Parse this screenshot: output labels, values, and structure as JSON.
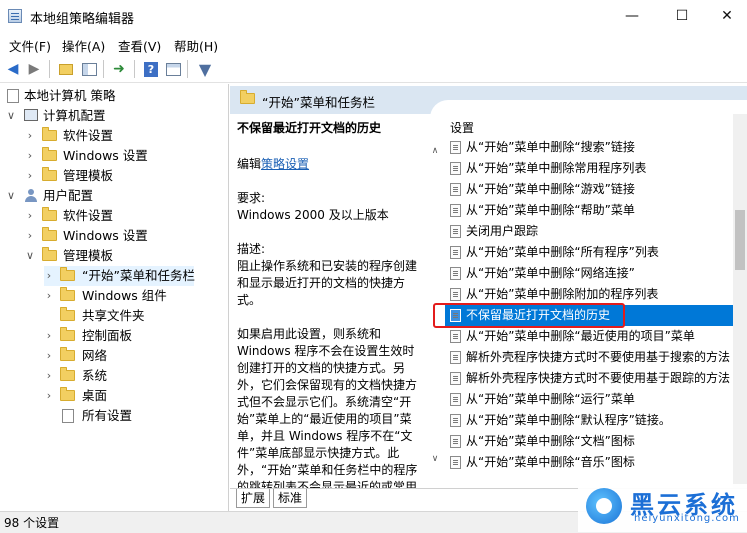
{
  "window": {
    "title": "本地组策略编辑器",
    "minimize": "—",
    "maximize": "☐",
    "close": "✕"
  },
  "menu": [
    "文件(F)",
    "操作(A)",
    "查看(V)",
    "帮助(H)"
  ],
  "toolbar": {
    "icons": [
      "back-icon",
      "forward-icon",
      "folder-up-icon",
      "show-hide-tree-icon",
      "export-icon",
      "help-icon",
      "properties-icon",
      "filter-icon"
    ]
  },
  "tree": {
    "root": "本地计算机 策略",
    "computer": "计算机配置",
    "computer_children": [
      "软件设置",
      "Windows 设置",
      "管理模板"
    ],
    "user": "用户配置",
    "user_children": [
      "软件设置",
      "Windows 设置",
      "管理模板"
    ],
    "admin_children": [
      "“开始”菜单和任务栏",
      "Windows 组件",
      "共享文件夹",
      "控制面板",
      "网络",
      "系统",
      "桌面",
      "所有设置"
    ],
    "expand_open": "∨",
    "expand_closed": "›"
  },
  "header": {
    "title": "“开始”菜单和任务栏"
  },
  "description": {
    "title": "不保留最近打开文档的历史",
    "edit_prefix": "编辑",
    "edit_link": "策略设置",
    "requirements_label": "要求:",
    "requirements": "Windows 2000 及以上版本",
    "desc_label": "描述:",
    "desc": "阻止操作系统和已安装的程序创建和显示最近打开的文档的快捷方式。",
    "detail": "如果启用此设置，则系统和 Windows 程序不会在设置生效时创建打开的文档的快捷方式。另外，它们会保留现有的文档快捷方式但不会显示它们。系统清空“开始”菜单上的“最近使用的项目”菜单，并且 Windows 程序不在“文件”菜单底部显示快捷方式。此外，“开始”菜单和任务栏中的程序的跳转列表不会显示最近的或常用的文件"
  },
  "settings": {
    "header": "设置",
    "items": [
      "从“开始”菜单中删除“搜索”链接",
      "从“开始”菜单中删除常用程序列表",
      "从“开始”菜单中删除“游戏”链接",
      "从“开始”菜单中删除“帮助”菜单",
      "关闭用户跟踪",
      "从“开始”菜单中删除“所有程序”列表",
      "从“开始”菜单中删除“网络连接”",
      "从“开始”菜单中删除附加的程序列表",
      "不保留最近打开文档的历史",
      "从“开始”菜单中删除“最近使用的项目”菜单",
      "解析外壳程序快捷方式时不要使用基于搜索的方法",
      "解析外壳程序快捷方式时不要使用基于跟踪的方法",
      "从“开始”菜单中删除“运行”菜单",
      "从“开始”菜单中删除“默认程序”链接。",
      "从“开始”菜单中删除“文档”图标",
      "从“开始”菜单中删除“音乐”图标"
    ],
    "selected_index": 8
  },
  "tabs": [
    "扩展",
    "标准"
  ],
  "status": "98 个设置",
  "watermark": {
    "text": "黑云系统",
    "sub": "heiyunxitong.com"
  }
}
